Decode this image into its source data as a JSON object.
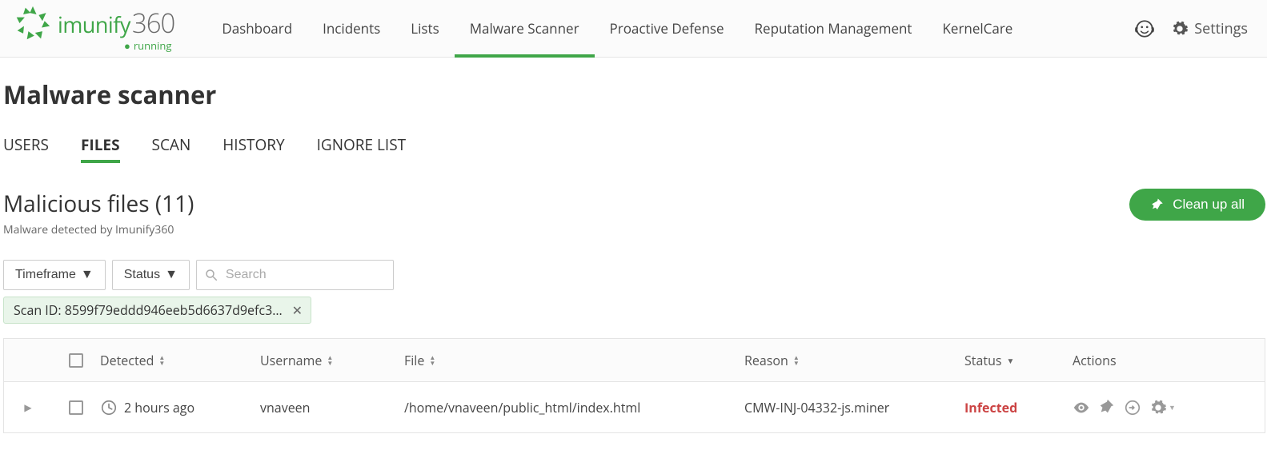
{
  "app": {
    "brand_a": "imunify",
    "brand_b": "360",
    "status_label": "running"
  },
  "nav": {
    "items": [
      {
        "label": "Dashboard"
      },
      {
        "label": "Incidents"
      },
      {
        "label": "Lists"
      },
      {
        "label": "Malware Scanner",
        "active": true
      },
      {
        "label": "Proactive Defense"
      },
      {
        "label": "Reputation Management"
      },
      {
        "label": "KernelCare"
      }
    ],
    "settings_label": "Settings"
  },
  "page_title": "Malware scanner",
  "subtabs": [
    {
      "label": "USERS"
    },
    {
      "label": "FILES",
      "active": true
    },
    {
      "label": "SCAN"
    },
    {
      "label": "HISTORY"
    },
    {
      "label": "IGNORE LIST"
    }
  ],
  "section": {
    "title": "Malicious files (11)",
    "subtitle": "Malware detected by Imunify360",
    "cleanup_label": "Clean up all"
  },
  "filters": {
    "timeframe_label": "Timeframe",
    "status_label": "Status",
    "search_placeholder": "Search",
    "chip_text": "Scan ID: 8599f79eddd946eeb5d6637d9efc3…"
  },
  "table": {
    "columns": {
      "detected": "Detected",
      "username": "Username",
      "file": "File",
      "reason": "Reason",
      "status": "Status",
      "actions": "Actions"
    },
    "rows": [
      {
        "detected": "2 hours ago",
        "username": "vnaveen",
        "file": "/home/vnaveen/public_html/index.html",
        "reason": "CMW-INJ-04332-js.miner",
        "status": "Infected"
      }
    ]
  }
}
